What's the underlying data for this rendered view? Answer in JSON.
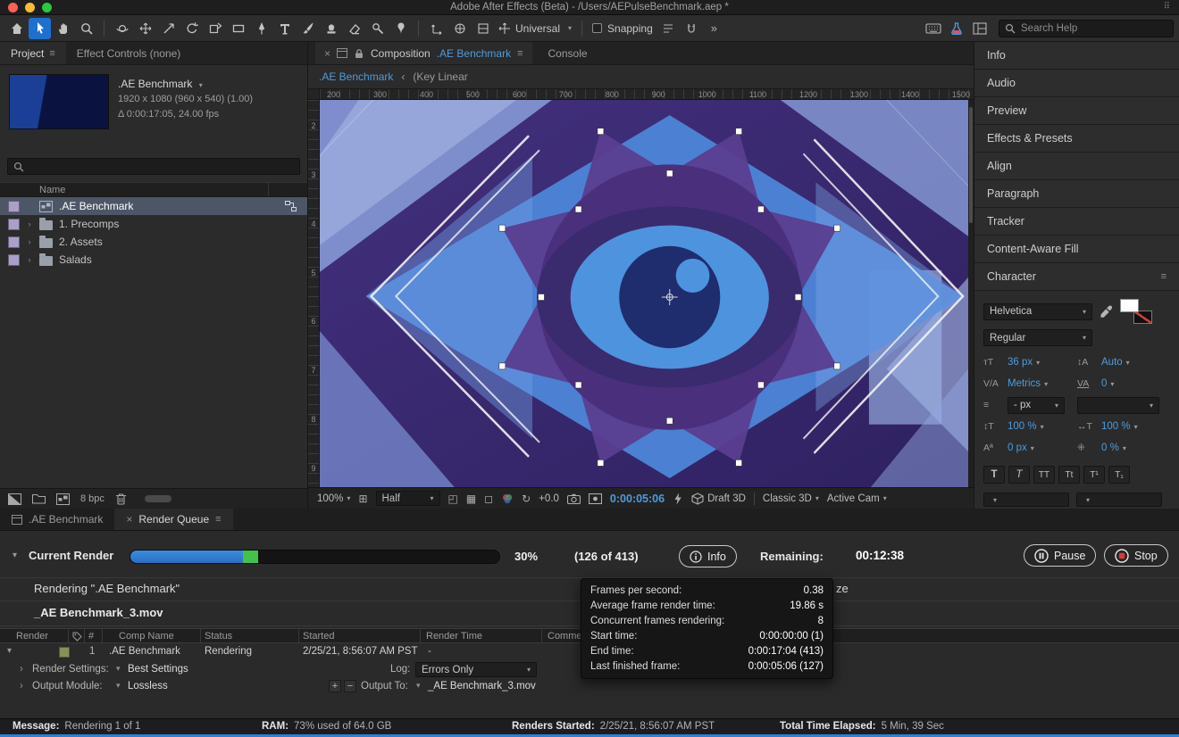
{
  "titlebar": {
    "title": "Adobe After Effects (Beta) - /Users/AEPulseBenchmark.aep *"
  },
  "toolbar": {
    "universal_label": "Universal",
    "snapping_label": "Snapping",
    "search_placeholder": "Search Help"
  },
  "project_panel": {
    "tab_project": "Project",
    "tab_effect_controls": "Effect Controls (none)",
    "comp_title": ".AE Benchmark",
    "comp_info_line1": "1920 x 1080  (960 x 540)  (1.00)",
    "comp_info_line2": "Δ 0:00:17:05, 24.00 fps",
    "name_header": "Name",
    "items": [
      {
        "label": ".AE Benchmark",
        "type": "composition"
      },
      {
        "label": "1. Precomps",
        "type": "folder"
      },
      {
        "label": "2. Assets",
        "type": "folder"
      },
      {
        "label": "Salads",
        "type": "folder"
      }
    ],
    "bpc_label": "8 bpc"
  },
  "composition_panel": {
    "tab_composition_label": "Composition",
    "tab_composition_comp": ".AE Benchmark",
    "tab_console": "Console",
    "breadcrumb_comp": ".AE Benchmark",
    "breadcrumb_sep": "‹",
    "breadcrumb_info": "(Key Linear",
    "ruler_h": [
      "200",
      "300",
      "400",
      "500",
      "600",
      "700",
      "800",
      "900",
      "1000",
      "1100",
      "1200",
      "1300",
      "1400",
      "1500"
    ],
    "ruler_v": [
      "2",
      "3",
      "4",
      "5",
      "6",
      "7",
      "8",
      "9"
    ],
    "bottom": {
      "zoom": "100%",
      "resolution": "Half",
      "exposure": "+0.0",
      "timecode": "0:00:05:06",
      "draft_3d": "Draft 3D",
      "renderer": "Classic 3D",
      "camera": "Active Cam"
    }
  },
  "right_panel": {
    "panels": [
      {
        "label": "Info"
      },
      {
        "label": "Audio"
      },
      {
        "label": "Preview"
      },
      {
        "label": "Effects & Presets"
      },
      {
        "label": "Align"
      },
      {
        "label": "Paragraph"
      },
      {
        "label": "Tracker"
      },
      {
        "label": "Content-Aware Fill"
      },
      {
        "label": "Character"
      }
    ],
    "character": {
      "font_family": "Helvetica",
      "font_style": "Regular",
      "font_size": "36 px",
      "leading": "Auto",
      "kerning": "Metrics",
      "tracking": "0",
      "stroke_width": "- px",
      "vertical_scale": "100 %",
      "horizontal_scale": "100 %",
      "baseline_shift": "0 px",
      "tsume": "0 %",
      "style_buttons": [
        "T",
        "T",
        "TT",
        "Tt",
        "T¹",
        "T₁"
      ]
    }
  },
  "render_queue": {
    "tab_comp": ".AE Benchmark",
    "tab_queue": "Render Queue",
    "current_render_label": "Current Render",
    "progress_percent": "30%",
    "progress_fraction": 0.305,
    "concurrent_fraction": 0.042,
    "frame_count": "(126 of 413)",
    "info_button_label": "Info",
    "remaining_label": "Remaining:",
    "remaining_time": "00:12:38",
    "rendering_title": "Rendering \".AE Benchmark\"",
    "obscured_fragment": "ze",
    "rendering_file": "_AE Benchmark_3.mov",
    "pause_label": "Pause",
    "stop_label": "Stop",
    "columns": [
      "Render",
      "#",
      "Comp Name",
      "Status",
      "Started",
      "Render Time",
      "Comment"
    ],
    "row": {
      "index": "1",
      "comp_name": ".AE Benchmark",
      "status": "Rendering",
      "started": "2/25/21, 8:56:07 AM PST",
      "render_time": "-"
    },
    "render_settings_label": "Render Settings:",
    "render_settings_value": "Best Settings",
    "log_label": "Log:",
    "log_value": "Errors Only",
    "output_module_label": "Output Module:",
    "output_module_value": "Lossless",
    "output_to_label": "Output To:",
    "output_to_value": "_AE Benchmark_3.mov"
  },
  "info_tooltip": {
    "rows": [
      {
        "label": "Frames per second:",
        "value": "0.38"
      },
      {
        "label": "Average frame render time:",
        "value": "19.86 s"
      },
      {
        "label": "Concurrent frames rendering:",
        "value": "8"
      },
      {
        "label": "Start time:",
        "value": "0:00:00:00 (1)"
      },
      {
        "label": "End time:",
        "value": "0:00:17:04 (413)"
      },
      {
        "label": "Last finished frame:",
        "value": "0:00:05:06 (127)"
      }
    ]
  },
  "status_bar": {
    "message_label": "Message:",
    "message_value": "Rendering 1 of 1",
    "ram_label": "RAM:",
    "ram_value": "73% used of 64.0 GB",
    "renders_started_label": "Renders Started:",
    "renders_started_value": "2/25/21, 8:56:07 AM PST",
    "elapsed_label": "Total Time Elapsed:",
    "elapsed_value": "5 Min, 39 Sec"
  },
  "colors": {
    "accent_blue": "#4e9bde",
    "progress_blue": "#2e7bd2",
    "progress_green": "#43c24b",
    "stop_red": "#d9363e"
  }
}
